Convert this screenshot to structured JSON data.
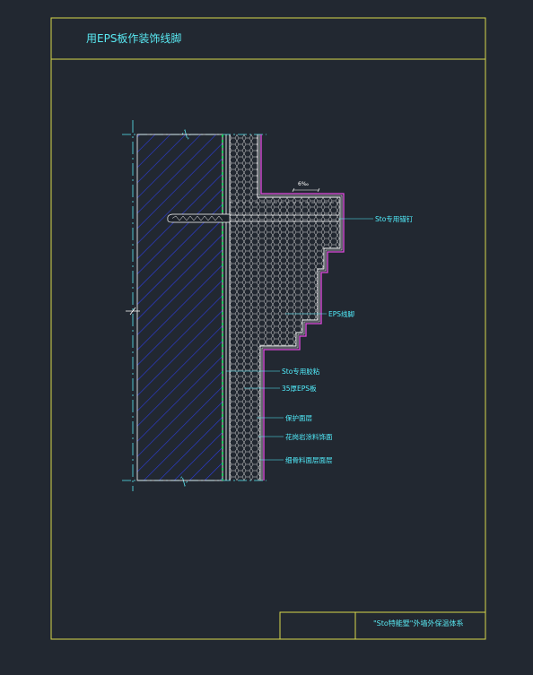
{
  "drawing": {
    "title": "用EPS板作装饰线脚",
    "title_block_name": "\"Sto特能墅\"外墙外保温体系",
    "dimension": "6‰"
  },
  "callouts": [
    {
      "id": "anchor",
      "text": "Sto专用锚钉"
    },
    {
      "id": "eps-line",
      "text": "EPS线脚"
    },
    {
      "id": "adhesive",
      "text": "Sto专用胶粘"
    },
    {
      "id": "eps-board",
      "text": "35厚EPS板"
    },
    {
      "id": "protect",
      "text": "保护面层"
    },
    {
      "id": "finish",
      "text": "花岗岩涂料饰面"
    },
    {
      "id": "base",
      "text": "细骨料面层面层"
    }
  ],
  "colors": {
    "background": "#222831",
    "frame": "#d8d84a",
    "label": "#52f0ff",
    "wall_hatch": "#2d3de0",
    "insulation": "#d9d9d9",
    "finish_line": "#e24be0"
  }
}
